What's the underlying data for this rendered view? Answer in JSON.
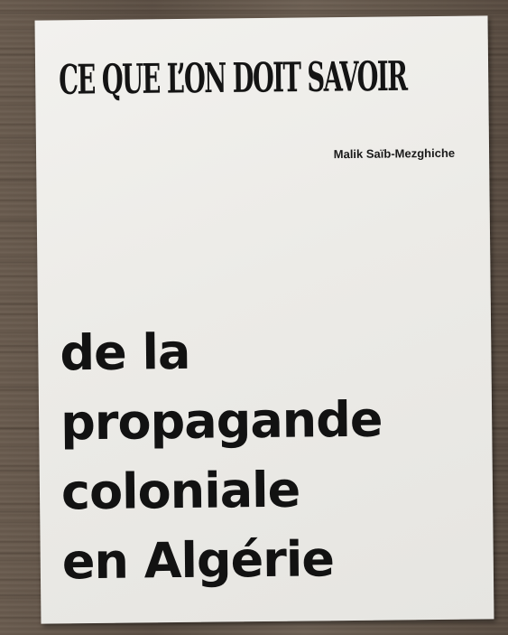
{
  "cover": {
    "series_title": "CE QUE L’ON DOIT SAVOIR",
    "author": "Malik Saïb-Mezghiche",
    "title_lines": [
      "de la",
      "propagande",
      "coloniale",
      "en Algérie"
    ]
  },
  "colors": {
    "paper": "#eceae6",
    "ink": "#141414",
    "wood": "#64574a"
  }
}
